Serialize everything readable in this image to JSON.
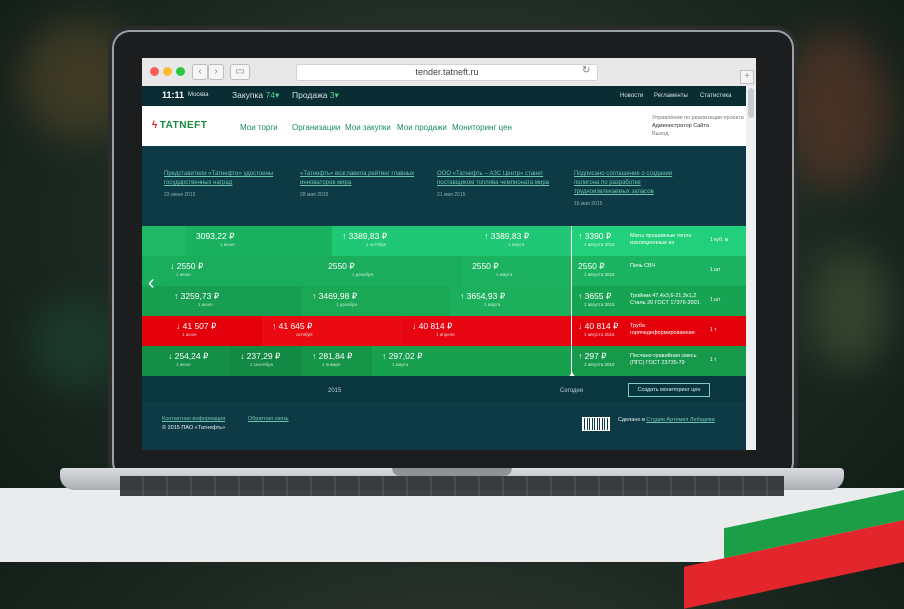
{
  "browser": {
    "url": "tender.tatneft.ru"
  },
  "topbar": {
    "time": "11:11",
    "city": "Москва",
    "purchase_label": "Закупка",
    "purchase_count": "74",
    "sale_label": "Продажа",
    "sale_count": "3",
    "links": [
      "Новости",
      "Регламенты",
      "Статистика"
    ]
  },
  "header": {
    "logo": "TATNEFT",
    "menu": [
      "Мои торги",
      "Организации",
      "Мои закупки",
      "Мои продажи",
      "Мониторинг цен"
    ],
    "user_line1": "Управление по реализации проекта",
    "user_name": "Администратор Сайта",
    "logout": "Выход"
  },
  "news": [
    {
      "title": "Представители «Татнефти» удостоены государственных наград",
      "date": "23 июня 2015"
    },
    {
      "title": "«Татнефть» возглавила рейтинг главных инноваторов мира",
      "date": "28 мая 2015"
    },
    {
      "title": "ООО «Татнефть – АЗС Центр» станет поставщиком топлива чемпионата мира",
      "date": "21 мая 2015"
    },
    {
      "title": "Подписано соглашение о создании полигона по разработке трудноизвлекаемых запасов",
      "date": "16 мая 2015"
    }
  ],
  "rows": [
    {
      "cells": [
        {
          "price": "3093,22 ₽",
          "date": "1 июня",
          "arrow": ""
        },
        {
          "price": "3389,83 ₽",
          "date": "1 октября",
          "arrow": "↑"
        },
        {
          "price": "3389,83 ₽",
          "date": "1 марта",
          "arrow": "↑"
        }
      ],
      "current": {
        "price": "3390 ₽",
        "date": "1 августа 2015",
        "arrow": "↑"
      },
      "name": "Маты прошивные тепло изоляционные из",
      "qty": "1 куб. м"
    },
    {
      "cells": [
        {
          "price": "2550 ₽",
          "date": "1 июня",
          "arrow": "↓"
        },
        {
          "price": "2550 ₽",
          "date": "1 декабря",
          "arrow": ""
        },
        {
          "price": "2550 ₽",
          "date": "1 марта",
          "arrow": ""
        }
      ],
      "current": {
        "price": "2550 ₽",
        "date": "1 августа 2015",
        "arrow": ""
      },
      "name": "Печь СВЧ",
      "qty": "1 шт"
    },
    {
      "cells": [
        {
          "price": "3259,73 ₽",
          "date": "1 июня",
          "arrow": "↑"
        },
        {
          "price": "3469,98 ₽",
          "date": "1 декабря",
          "arrow": "↑"
        },
        {
          "price": "3654,93 ₽",
          "date": "1 марта",
          "arrow": "↑"
        }
      ],
      "current": {
        "price": "3655 ₽",
        "date": "1 августа 2015",
        "arrow": "↑"
      },
      "name": "Тройник 47,4х3,6-21,3х1,2 Сталь 20 ГОСТ 17376-2001",
      "qty": "1 шт"
    },
    {
      "cells": [
        {
          "price": "41 507 ₽",
          "date": "1 июня",
          "arrow": "↓"
        },
        {
          "price": "41 645 ₽",
          "date": "октября",
          "arrow": "↑"
        },
        {
          "price": "40 814 ₽",
          "date": "1 апреля",
          "arrow": "↓"
        }
      ],
      "current": {
        "price": "40 814 ₽",
        "date": "1 августа 2015",
        "arrow": "↓"
      },
      "name": "Труба горячедеформированная",
      "qty": "1 т"
    },
    {
      "cells": [
        {
          "price": "254,24 ₽",
          "date": "1 июня",
          "arrow": "↓"
        },
        {
          "price": "237,29 ₽",
          "date": "1 сентября",
          "arrow": "↓"
        },
        {
          "price": "281,84 ₽",
          "date": "1 января",
          "arrow": "↑"
        },
        {
          "price": "297,02 ₽",
          "date": "1 марта",
          "arrow": "↑"
        }
      ],
      "current": {
        "price": "297 ₽",
        "date": "1 августа 2015",
        "arrow": "↑"
      },
      "name": "Песчано-гравийная смесь (ПГС) ГОСТ 23735-79",
      "qty": "1 т"
    }
  ],
  "timeline": {
    "year": "2015",
    "today": "Сегодня",
    "create_button": "Создать мониторинг цен"
  },
  "footer": {
    "contact": "Контактная информация",
    "feedback": "Обратная связь",
    "copyright": "© 2015 ПАО «Татнефть»",
    "made_prefix": "Сделано в",
    "made_studio": "Студии Артемия Лебедева"
  },
  "colors": {
    "green_dark": "#159a48",
    "green_mid": "#1bb35a",
    "green_light": "#20c775",
    "red": "#e3000b",
    "teal": "#0d3a44"
  }
}
